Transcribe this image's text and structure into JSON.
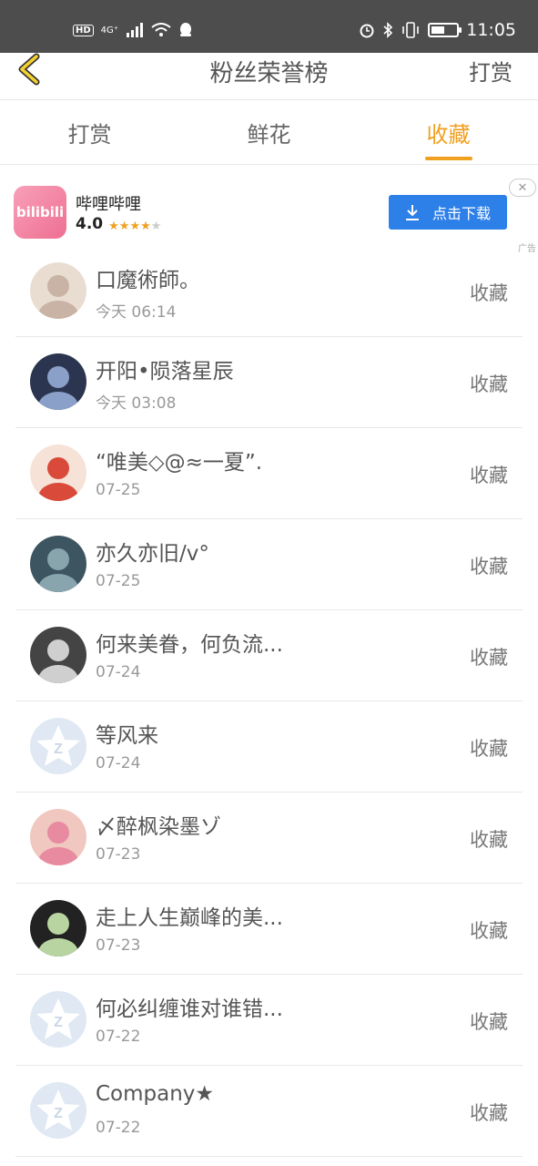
{
  "status_bar": {
    "hd": "HD",
    "network": "4G⁺",
    "time": "11:05",
    "icons": [
      "signal-icon",
      "wifi-icon",
      "qq-icon",
      "alarm-icon",
      "bluetooth-icon",
      "vibrate-icon",
      "battery-icon"
    ]
  },
  "nav": {
    "title": "粉丝荣誉榜",
    "right_action": "打赏",
    "back_icon": "chevron-left-icon"
  },
  "tabs": [
    {
      "label": "打赏",
      "active": false
    },
    {
      "label": "鲜花",
      "active": false
    },
    {
      "label": "收藏",
      "active": true
    }
  ],
  "accent_color": "#f0a020",
  "ad": {
    "app_icon_text": "bilibili",
    "app_name": "哔哩哔哩",
    "rating": "4.0",
    "stars_on": 4,
    "stars_total": 5,
    "download_label": "点击下载",
    "close_symbol": "✕",
    "ad_tag": "广告",
    "button_color": "#2d80e8"
  },
  "list": [
    {
      "name": "口魔術師。",
      "time": "今天 06:14",
      "action": "收藏",
      "avatar": "photo"
    },
    {
      "name": "开阳•陨落星辰",
      "time": "今天 03:08",
      "action": "收藏",
      "avatar": "photo"
    },
    {
      "name": "“唯美◇@≈一夏”.",
      "time": "07-25",
      "action": "收藏",
      "avatar": "photo"
    },
    {
      "name": "亦久亦旧/v°",
      "time": "07-25",
      "action": "收藏",
      "avatar": "photo"
    },
    {
      "name": "何来美眷，何负流...",
      "time": "07-24",
      "action": "收藏",
      "avatar": "photo"
    },
    {
      "name": "等风来",
      "time": "07-24",
      "action": "收藏",
      "avatar": "default"
    },
    {
      "name": "〆醉枫染墨ゾ",
      "time": "07-23",
      "action": "收藏",
      "avatar": "photo"
    },
    {
      "name": "走上人生巅峰的美...",
      "time": "07-23",
      "action": "收藏",
      "avatar": "photo"
    },
    {
      "name": "何必纠缠谁对谁错...",
      "time": "07-22",
      "action": "收藏",
      "avatar": "default"
    },
    {
      "name": "Company★",
      "time": "07-22",
      "action": "收藏",
      "avatar": "default"
    }
  ]
}
